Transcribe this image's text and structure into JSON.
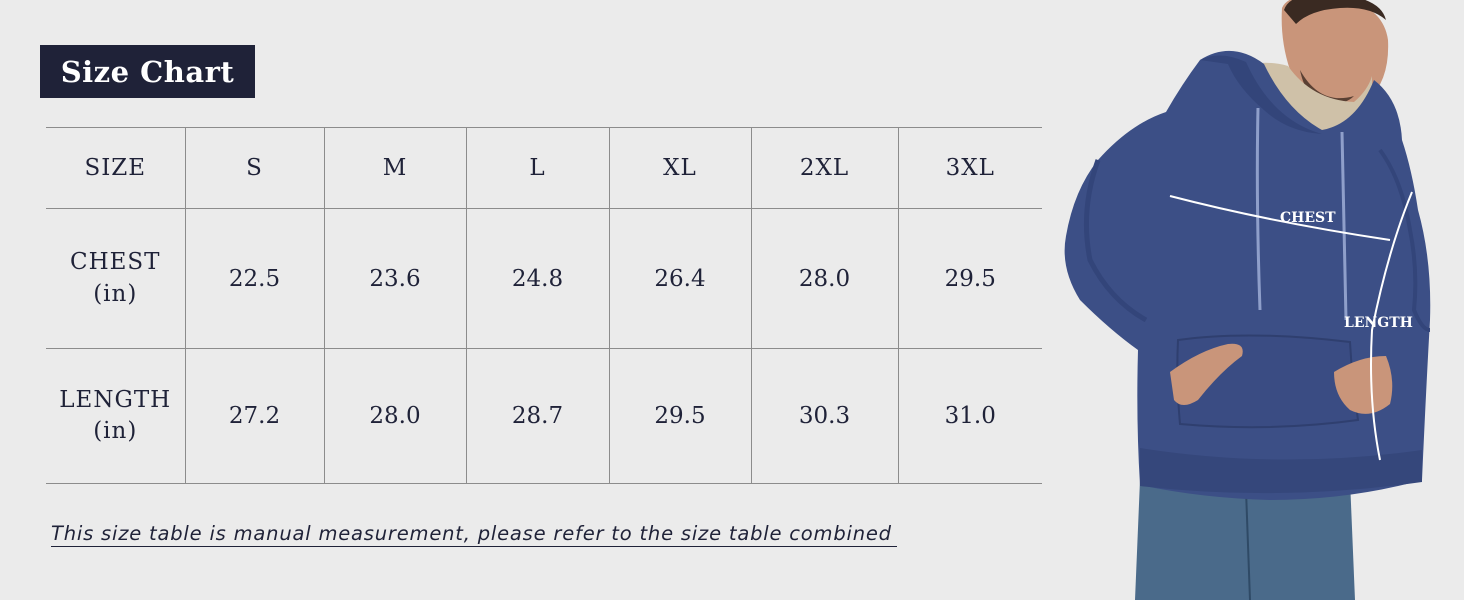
{
  "title": "Size Chart",
  "table": {
    "columns": [
      "SIZE",
      "S",
      "M",
      "L",
      "XL",
      "2XL",
      "3XL"
    ],
    "rows": [
      {
        "label": "CHEST",
        "unit": "(in)",
        "values": [
          "22.5",
          "23.6",
          "24.8",
          "26.4",
          "28.0",
          "29.5"
        ]
      },
      {
        "label": "LENGTH",
        "unit": "(in)",
        "values": [
          "27.2",
          "28.0",
          "28.7",
          "29.5",
          "30.3",
          "31.0"
        ]
      }
    ]
  },
  "note": "This size table is manual measurement, please refer to the size table combined",
  "model": {
    "chest_label": "CHEST",
    "length_label": "LENGTH",
    "hoodie_color": "#3c4f86"
  }
}
